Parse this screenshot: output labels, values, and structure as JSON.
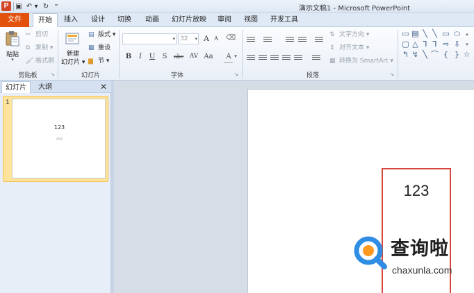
{
  "titlebar": {
    "app_icon": "P",
    "window_title": "演示文稿1 - Microsoft PowerPoint",
    "qat": [
      {
        "name": "save-icon",
        "glyph": "▣"
      },
      {
        "name": "undo-icon",
        "glyph": "↶"
      },
      {
        "name": "customize-qat-icon",
        "glyph": "▾"
      },
      {
        "name": "redo-icon",
        "glyph": "↻"
      },
      {
        "name": "qat-menu-icon",
        "glyph": "⁼"
      }
    ]
  },
  "tabs": [
    "文件",
    "开始",
    "插入",
    "设计",
    "切换",
    "动画",
    "幻灯片放映",
    "审阅",
    "视图",
    "开发工具"
  ],
  "ribbon": {
    "clipboard": {
      "paste": "粘贴",
      "cut": "剪切",
      "copy": "复制",
      "format_painter": "格式刷",
      "label": "剪贴板"
    },
    "slides": {
      "new_slide": "新建",
      "new_slide_line2": "幻灯片",
      "layout": "版式",
      "reset": "重设",
      "section": "节",
      "label": "幻灯片"
    },
    "font": {
      "size": "32",
      "grow": "A",
      "shrink": "A",
      "bold": "B",
      "italic": "I",
      "underline": "U",
      "strike": "S",
      "shadow": "abc",
      "spacing": "AV",
      "case": "Aa",
      "color": "A",
      "label": "字体"
    },
    "paragraph": {
      "text_direction": "文字方向",
      "align_text": "对齐文本",
      "smartart": "转换为 SmartArt",
      "label": "段落"
    },
    "drawing": {
      "shapes": [
        "▭",
        "▤",
        "╲",
        "╲",
        "▭",
        "⬭",
        "▢",
        "△",
        "⅂",
        "⅂",
        "⇨",
        "⇩",
        "↰",
        "↯",
        "╲",
        "⌒",
        "{",
        "}",
        "☆"
      ]
    }
  },
  "leftpane": {
    "tab_slides": "幻灯片",
    "tab_outline": "大纲",
    "close": "✕",
    "thumb_number": "1",
    "thumb_title": "123",
    "thumb_subtitle": "456"
  },
  "slide": {
    "placeholder_text": "123"
  },
  "watermark": {
    "title": "查询啦",
    "url": "chaxunla.com"
  }
}
